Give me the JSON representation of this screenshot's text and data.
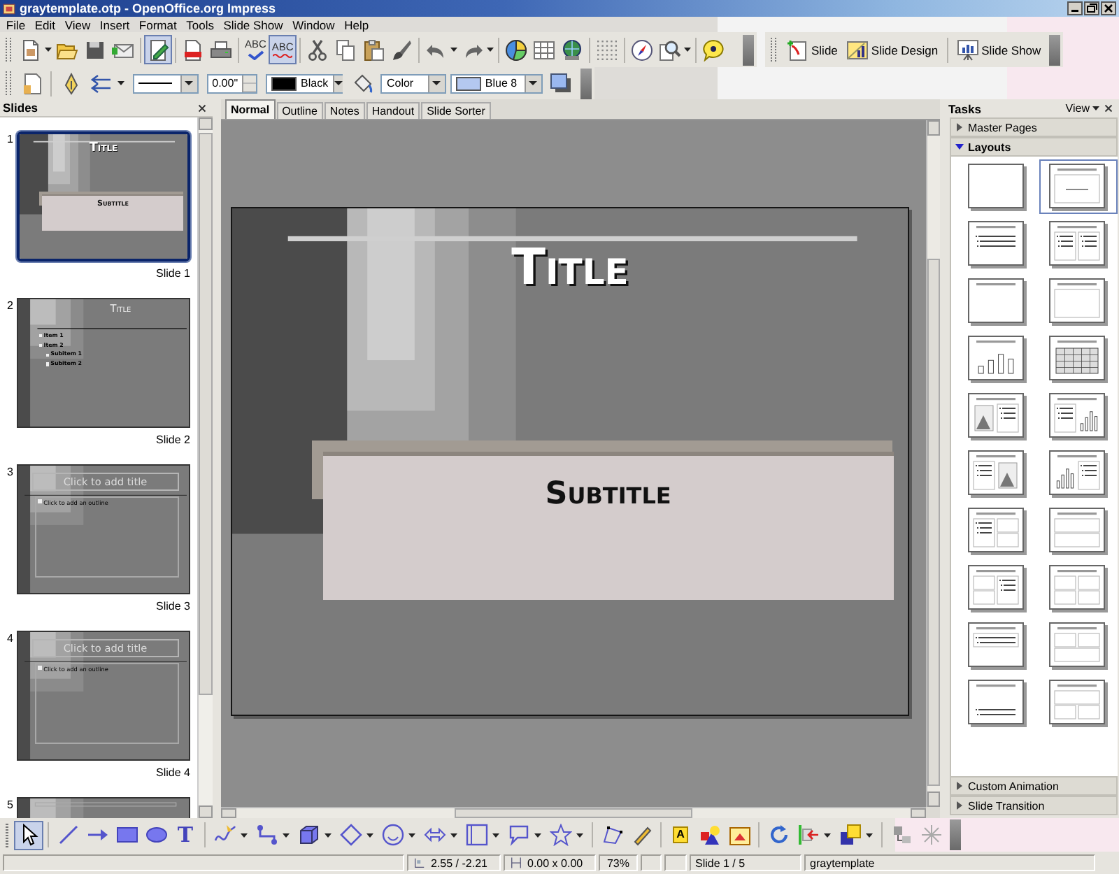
{
  "window": {
    "title": "graytemplate.otp - OpenOffice.org Impress"
  },
  "menu": [
    "File",
    "Edit",
    "View",
    "Insert",
    "Format",
    "Tools",
    "Slide Show",
    "Window",
    "Help"
  ],
  "standard_toolbar": {
    "edit_mode_pressed": true,
    "spellcheck_label": "ABC",
    "autospell_label": "ABC",
    "autospell_pressed": true,
    "buttons": [
      "Slide",
      "Slide Design",
      "Slide Show"
    ]
  },
  "line_toolbar": {
    "line_width": "0.00\"",
    "line_color": "Black",
    "area_style": "Color",
    "area_color": "Blue 8"
  },
  "slides_panel": {
    "title": "Slides",
    "slides": [
      {
        "number": "1",
        "kind": "title",
        "selected": true,
        "title": "Title",
        "subtitle": "Subtitle",
        "caption": "Slide 1"
      },
      {
        "number": "2",
        "kind": "bullets",
        "selected": false,
        "title": "Title",
        "items": [
          {
            "text": "Item 1"
          },
          {
            "text": "Item 2",
            "children": [
              {
                "text": "Subitem 1"
              },
              {
                "text": "Subitem 2"
              }
            ]
          }
        ],
        "caption": "Slide 2"
      },
      {
        "number": "3",
        "kind": "placeholder",
        "selected": false,
        "title": "Click to add title",
        "outline": "Click to add an outline",
        "caption": "Slide 3"
      },
      {
        "number": "4",
        "kind": "placeholder",
        "selected": false,
        "title": "Click to add title",
        "outline": "Click to add an outline",
        "caption": "Slide 4"
      },
      {
        "number": "5",
        "kind": "cut",
        "selected": false
      }
    ]
  },
  "editor": {
    "tabs": [
      {
        "label": "Normal",
        "selected": true
      },
      {
        "label": "Outline",
        "selected": false
      },
      {
        "label": "Notes",
        "selected": false
      },
      {
        "label": "Handout",
        "selected": false
      },
      {
        "label": "Slide Sorter",
        "selected": false
      }
    ],
    "slide": {
      "kind": "title",
      "title": "Title",
      "subtitle": "Subtitle"
    }
  },
  "tasks_panel": {
    "title": "Tasks",
    "view_menu": "View",
    "sections": [
      {
        "title": "Master Pages",
        "expanded": false
      },
      {
        "title": "Layouts",
        "expanded": true
      }
    ],
    "layouts": [
      {
        "kind": "blank",
        "selected": false
      },
      {
        "kind": "title-subtitle",
        "selected": true
      },
      {
        "kind": "title-list",
        "selected": false
      },
      {
        "kind": "title-2list",
        "selected": false
      },
      {
        "kind": "title-only",
        "selected": false
      },
      {
        "kind": "title-box",
        "selected": false
      },
      {
        "kind": "title-chart",
        "selected": false
      },
      {
        "kind": "title-table",
        "selected": false
      },
      {
        "kind": "picture-list",
        "selected": false
      },
      {
        "kind": "list-chart",
        "selected": false
      },
      {
        "kind": "list-picture",
        "selected": false
      },
      {
        "kind": "chart-list",
        "selected": false
      },
      {
        "kind": "list-2box",
        "selected": false
      },
      {
        "kind": "box-2stack",
        "selected": false
      },
      {
        "kind": "boxes-list",
        "selected": false
      },
      {
        "kind": "quad",
        "selected": false
      },
      {
        "kind": "list-top",
        "selected": false
      },
      {
        "kind": "boxes-box",
        "selected": false
      },
      {
        "kind": "list-wide",
        "selected": false
      },
      {
        "kind": "box-2box",
        "selected": false
      }
    ],
    "bottom_sections": [
      {
        "title": "Custom Animation",
        "expanded": false
      },
      {
        "title": "Slide Transition",
        "expanded": false
      }
    ]
  },
  "drawing_toolbar": {
    "select_pressed": true,
    "text_glyph": "T",
    "fontwork_glyph": "A"
  },
  "status_bar": {
    "position": "2.55 / -2.21",
    "size": "0.00 x 0.00",
    "zoom": "73%",
    "slide": "Slide 1 / 5",
    "master": "graytemplate"
  }
}
